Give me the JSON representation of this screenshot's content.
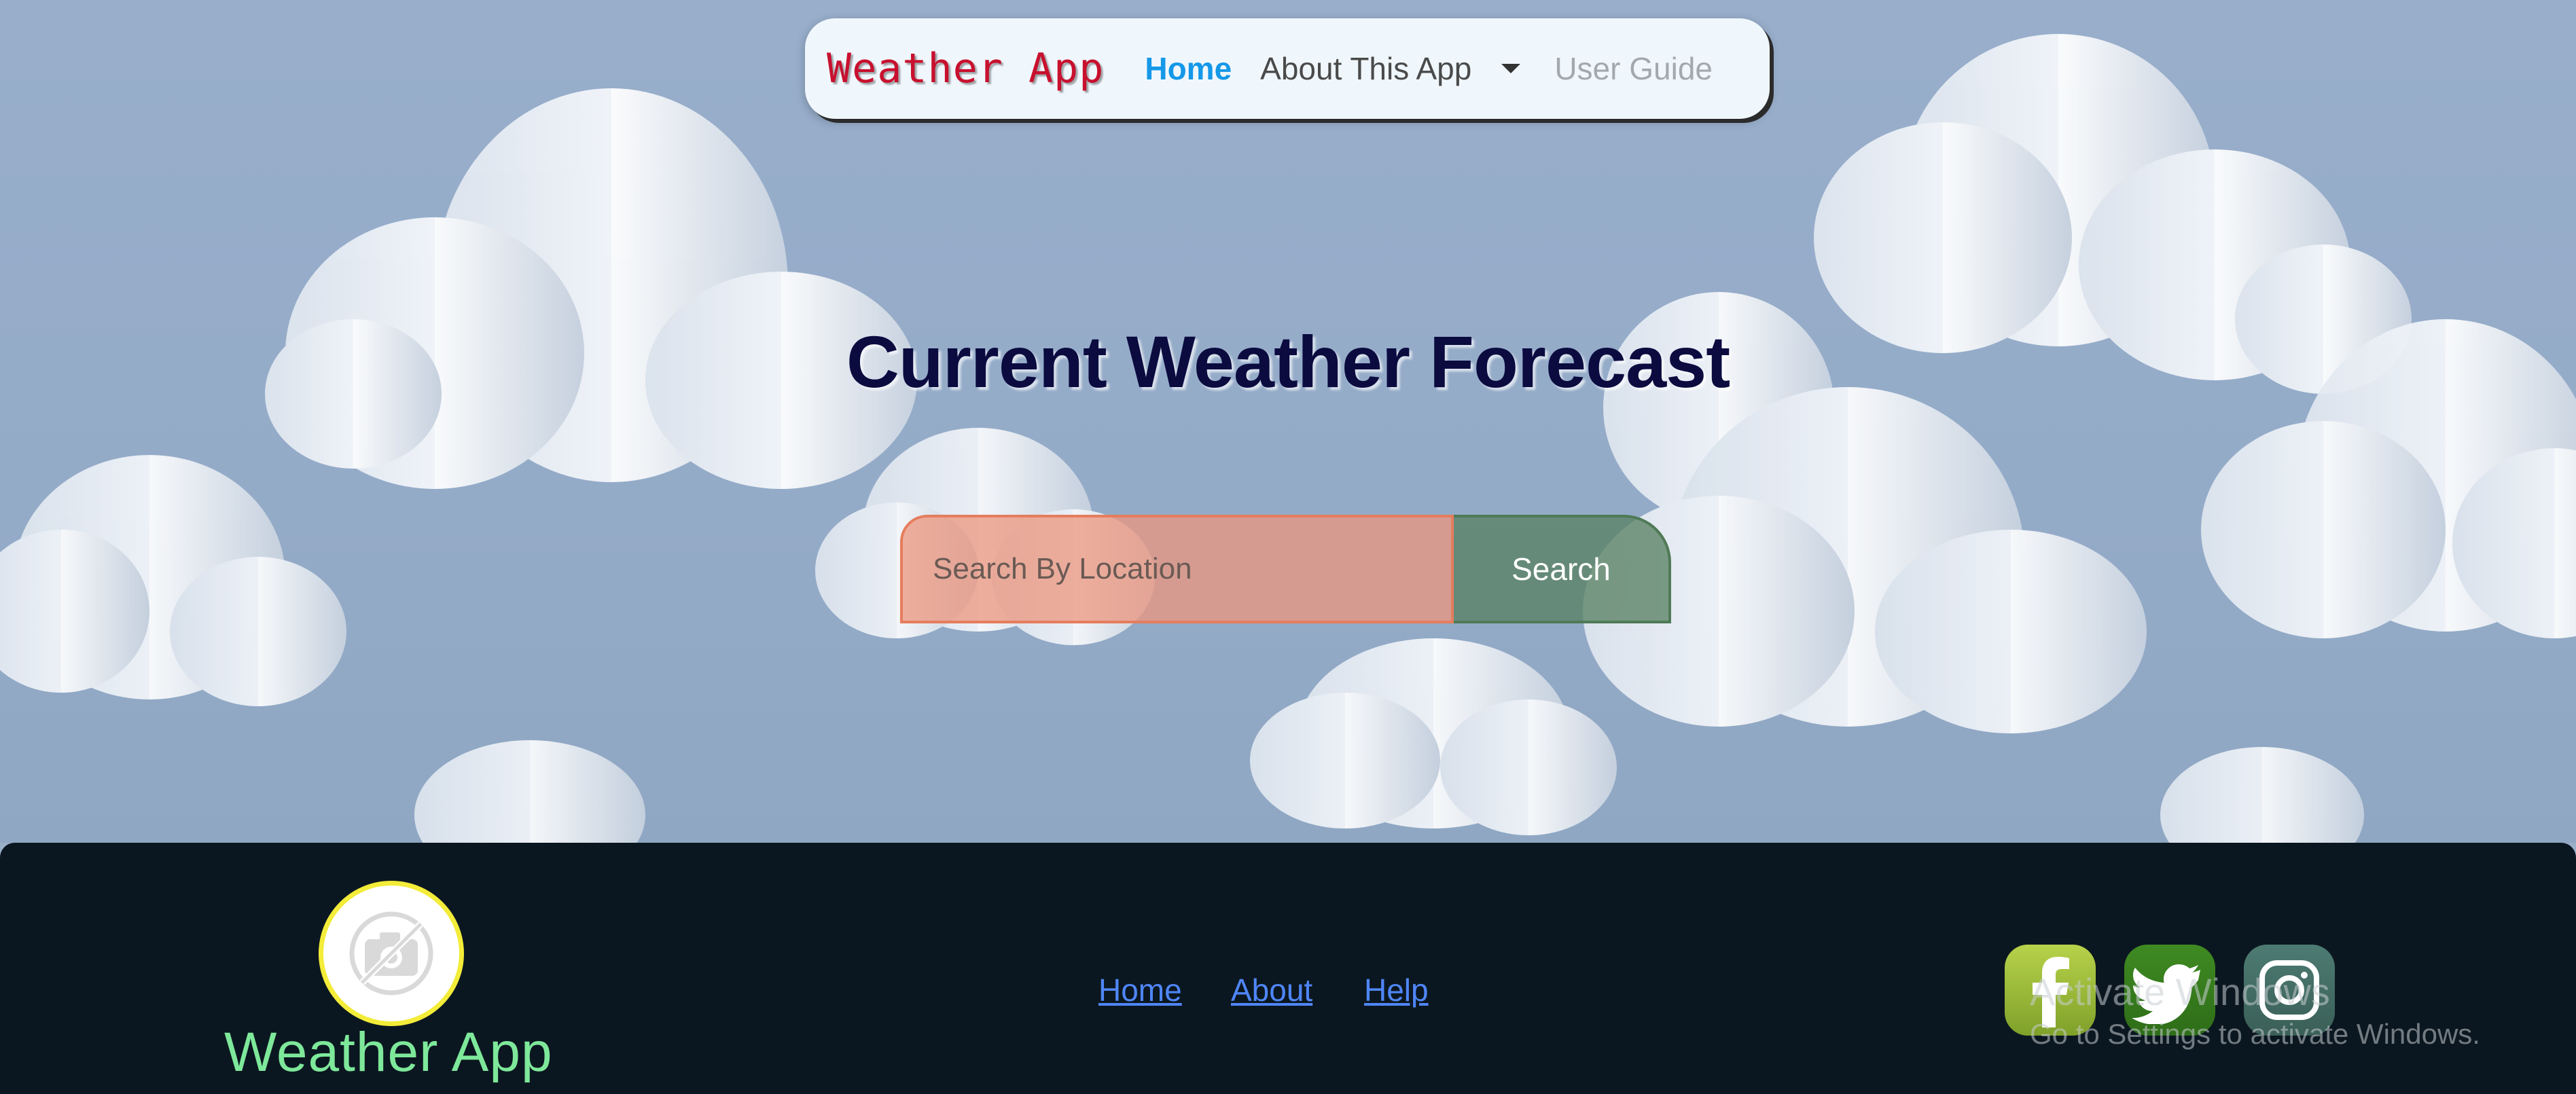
{
  "navbar": {
    "brand": "Weather App",
    "links": {
      "home": "Home",
      "about": "About This App",
      "guide": "User Guide"
    }
  },
  "hero": {
    "title": "Current Weather Forecast"
  },
  "search": {
    "placeholder": "Search By Location",
    "value": "",
    "button_label": "Search"
  },
  "footer": {
    "brand": "Weather App",
    "links": {
      "home": "Home",
      "about": "About",
      "help": "Help"
    },
    "social": [
      "facebook-icon",
      "twitter-icon",
      "instagram-icon"
    ]
  },
  "os_watermark": {
    "title": "Activate Windows",
    "subtitle": "Go to Settings to activate Windows."
  },
  "colors": {
    "brand_red": "#c8102e",
    "nav_active": "#1598e8",
    "footer_bg": "#0b1720",
    "footer_brand": "#7ee89a",
    "footer_link": "#4f86f7",
    "logo_ring": "#f3ec39"
  }
}
